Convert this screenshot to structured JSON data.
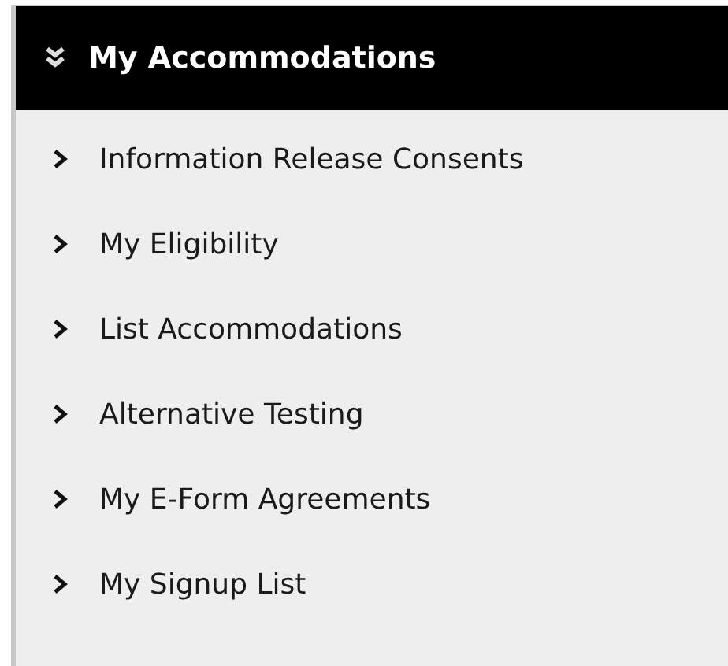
{
  "panel": {
    "title": "My Accommodations",
    "items": [
      {
        "label": "Information Release Consents"
      },
      {
        "label": "My Eligibility"
      },
      {
        "label": "List Accommodations"
      },
      {
        "label": "Alternative Testing"
      },
      {
        "label": "My E-Form Agreements"
      },
      {
        "label": "My Signup List"
      }
    ]
  }
}
